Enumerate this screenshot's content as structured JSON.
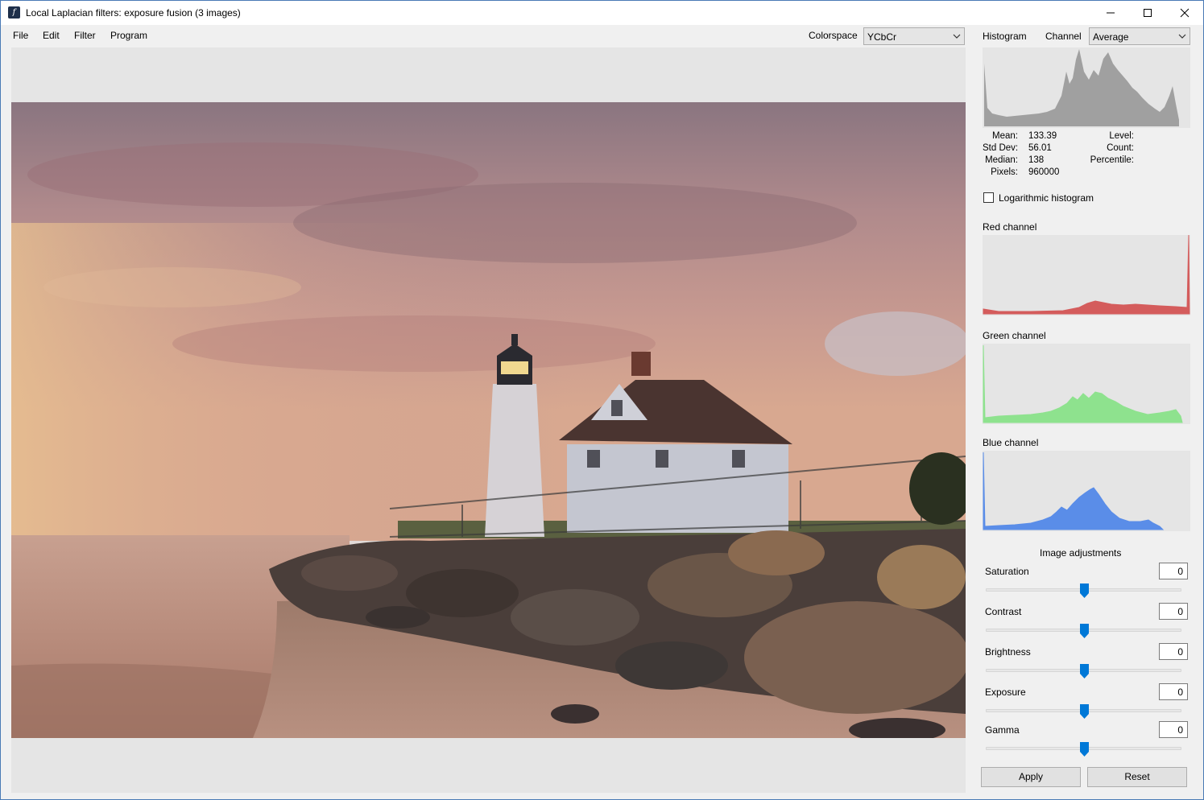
{
  "window": {
    "title": "Local Laplacian filters: exposure fusion (3 images)",
    "icon_name": "app-logo-icon",
    "controls": [
      "minimize-icon",
      "maximize-icon",
      "close-icon"
    ]
  },
  "menu": {
    "file": "File",
    "edit": "Edit",
    "filter": "Filter",
    "program": "Program"
  },
  "colorspace": {
    "label": "Colorspace",
    "value": "YCbCr"
  },
  "histogram": {
    "label": "Histogram",
    "channel_label": "Channel",
    "channel_value": "Average",
    "stats": {
      "mean_label": "Mean:",
      "mean": "133.39",
      "std_label": "Std Dev:",
      "std": "56.01",
      "median_label": "Median:",
      "median": "138",
      "pixels_label": "Pixels:",
      "pixels": "960000",
      "level_label": "Level:",
      "count_label": "Count:",
      "percentile_label": "Percentile:"
    },
    "log_label": "Logarithmic histogram",
    "log_checked": false
  },
  "channels": {
    "red_label": "Red channel",
    "green_label": "Green channel",
    "blue_label": "Blue channel",
    "colors": {
      "average": "#a0a0a0",
      "red": "#d45c5c",
      "green": "#8ee28e",
      "blue": "#5a8de8"
    }
  },
  "adjustments": {
    "title": "Image adjustments",
    "saturation_label": "Saturation",
    "saturation": "0",
    "contrast_label": "Contrast",
    "contrast": "0",
    "brightness_label": "Brightness",
    "brightness": "0",
    "exposure_label": "Exposure",
    "exposure": "0",
    "gamma_label": "Gamma",
    "gamma": "0"
  },
  "buttons": {
    "apply": "Apply",
    "reset": "Reset"
  },
  "accent_color": "#0078d7"
}
